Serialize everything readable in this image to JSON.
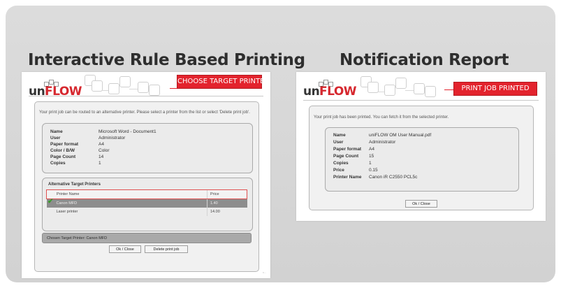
{
  "left": {
    "heading": "Interactive Rule Based Printing",
    "logo_uni": "uni",
    "logo_flow": "FLOW",
    "badge": "CHOOSE TARGET PRINTER",
    "message": "Your print job can be routed to an alternative printer. Please select a printer from the list or select 'Delete print job'.",
    "details": [
      {
        "key": "Name",
        "value": "Microsoft Word - Document1"
      },
      {
        "key": "User",
        "value": "Administrator"
      },
      {
        "key": "Paper format",
        "value": "A4"
      },
      {
        "key": "Color / B/W",
        "value": "Color"
      },
      {
        "key": "Page Count",
        "value": "14"
      },
      {
        "key": "Copies",
        "value": "1"
      }
    ],
    "alt_title": "Alternative Target Printers",
    "table_headers": {
      "name": "Printer Name",
      "price": "Price"
    },
    "printers": [
      {
        "name": "Canon MFD",
        "price": "1.40",
        "selected": true
      },
      {
        "name": "Laser printer",
        "price": "14.00",
        "selected": false
      }
    ],
    "chosen": "Chosen Target Printer: Canon MFD",
    "ok_button": "Ok / Close",
    "delete_button": "Delete print job",
    "footer_text": "v..."
  },
  "right": {
    "heading": "Notification Report",
    "logo_uni": "uni",
    "logo_flow": "FLOW",
    "badge": "PRINT JOB PRINTED",
    "message": "Your print job has been printed. You can fetch it from the selected printer.",
    "details": [
      {
        "key": "Name",
        "value": "uniFLOW OM User Manual.pdf"
      },
      {
        "key": "User",
        "value": "Administrator"
      },
      {
        "key": "Paper format",
        "value": "A4"
      },
      {
        "key": "Page Count",
        "value": "15"
      },
      {
        "key": "Copies",
        "value": "1"
      },
      {
        "key": "Price",
        "value": "0.15"
      },
      {
        "key": "Printer Name",
        "value": "Canon iR C2550 PCL5c"
      }
    ],
    "ok_button": "Ok / Close"
  },
  "colors": {
    "accent": "#e3232d",
    "frame": "#d6d6d6",
    "selected_row": "#8d8d8d"
  }
}
